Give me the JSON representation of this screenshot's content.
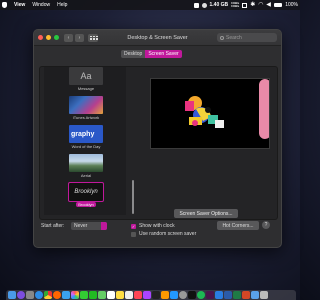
{
  "menubar": {
    "items": [
      "View",
      "Window",
      "Help"
    ],
    "status": {
      "net_up": "0 KB/s",
      "net_down": "0 KB/s",
      "clock": "1.40 GB",
      "battery": "100%"
    }
  },
  "window": {
    "title": "Desktop & Screen Saver",
    "search_placeholder": "Search",
    "tabs": [
      {
        "label": "Desktop"
      },
      {
        "label": "Screen Saver"
      }
    ],
    "active_tab": "Screen Saver",
    "savers": [
      {
        "label": "Message",
        "thumb_text": "Aa"
      },
      {
        "label": "iTunes Artwork"
      },
      {
        "label": "Word of the Day",
        "thumb_text": "graphy"
      },
      {
        "label": "Aerial"
      },
      {
        "label": "Brooklyn",
        "thumb_text": "Brooklyn",
        "selected": true
      }
    ],
    "options_button": "Screen Saver Options...",
    "start_after_label": "Start after:",
    "start_after_value": "Never",
    "show_clock": {
      "label": "Show with clock",
      "checked": true
    },
    "random": {
      "label": "Use random screen saver",
      "checked": false
    },
    "hot_corners": "Hot Corners...",
    "help": "?"
  },
  "colors": {
    "accent": "#c0189b"
  }
}
